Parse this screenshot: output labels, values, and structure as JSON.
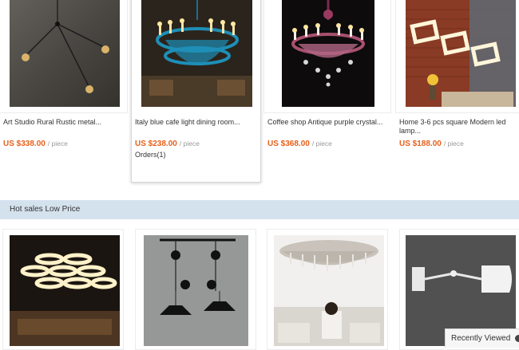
{
  "top_products": [
    {
      "title": "Art Studio Rural Rustic metal...",
      "price": "US $338.00",
      "unit": "/ piece",
      "image": "industrial-pulley-wall-lamp"
    },
    {
      "title": "Italy blue cafe light dining room...",
      "price": "US $238.00",
      "unit": "/ piece",
      "orders": "Orders(1)",
      "image": "blue-crystal-chandelier"
    },
    {
      "title": "Coffee shop Antique purple crystal...",
      "price": "US $368.00",
      "unit": "/ piece",
      "image": "purple-crystal-chandelier"
    },
    {
      "title": "Home 3-6 pcs square Modern led lamp...",
      "price": "US $188.00",
      "unit": "/ piece",
      "image": "square-led-pendant"
    }
  ],
  "section": {
    "title": "Hot sales Low Price"
  },
  "hot_products": [
    {
      "image": "ring-led-chandelier-dining-room"
    },
    {
      "image": "pulley-pendant-lamps"
    },
    {
      "image": "crystal-ceiling-lamp-living-room"
    },
    {
      "image": "white-swing-arm-wall-lamp"
    }
  ],
  "recently_viewed": {
    "label": "Recently Viewed",
    "icon": "arrow-circle-icon"
  }
}
